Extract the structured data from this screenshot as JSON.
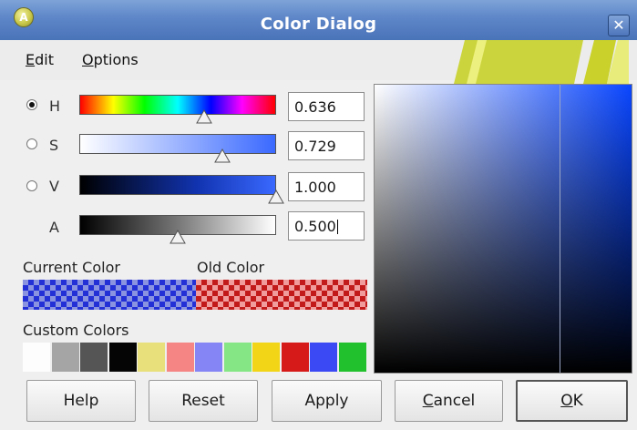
{
  "window": {
    "title": "Color Dialog",
    "app_icon_glyph": "A",
    "close_glyph": "✕"
  },
  "menu": {
    "items": [
      "Edit",
      "Options"
    ]
  },
  "sliders": [
    {
      "key": "H",
      "label": "H",
      "value_text": "0.636",
      "value": 0.636,
      "radio_selected": true
    },
    {
      "key": "S",
      "label": "S",
      "value_text": "0.729",
      "value": 0.729,
      "radio_selected": false
    },
    {
      "key": "V",
      "label": "V",
      "value_text": "1.000",
      "value": 1.0,
      "radio_selected": false
    },
    {
      "key": "A",
      "label": "A",
      "value_text": "0.500",
      "value": 0.5,
      "has_radio": false
    }
  ],
  "swatches": {
    "current_label": "Current Color",
    "old_label": "Old Color",
    "current_color": "#2230d6",
    "old_color": "#c21a1a"
  },
  "custom_colors": {
    "label": "Custom Colors",
    "colors": [
      "#fdfdfd",
      "#a5a5a5",
      "#555555",
      "#050505",
      "#e8e07a",
      "#f58585",
      "#8585f5",
      "#85e685",
      "#f2d516",
      "#d61a1a",
      "#3b49f5",
      "#21c12d"
    ]
  },
  "color_field": {
    "hue_color": "#0a46ff",
    "type": "saturation-value"
  },
  "buttons": {
    "help": "Help",
    "reset": "Reset",
    "apply": "Apply",
    "cancel": "Cancel",
    "ok": "OK"
  },
  "colors": {
    "titlebar": "#5d86c8",
    "background": "#efefef"
  },
  "icons": {
    "app": "app-logo-icon",
    "close": "close-icon",
    "thumb": "triangle-up-icon"
  }
}
